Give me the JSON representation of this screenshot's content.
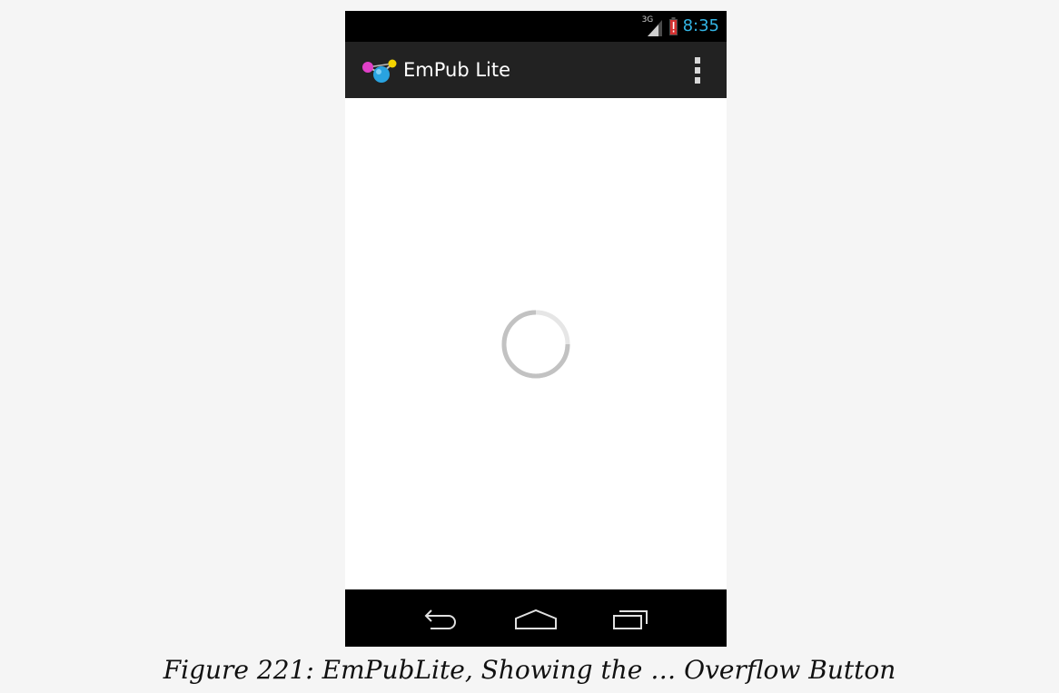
{
  "status_bar": {
    "network_type": "3G",
    "time": "8:35",
    "icons": [
      "signal-icon",
      "battery-low-icon"
    ]
  },
  "action_bar": {
    "app_icon": "empub-logo-icon",
    "title": "EmPub Lite",
    "overflow_icon": "overflow-menu-icon"
  },
  "content": {
    "loading_icon": "progress-spinner-icon"
  },
  "nav_bar": {
    "icons": [
      "back-icon",
      "home-icon",
      "recent-apps-icon"
    ]
  },
  "caption": "Figure 221: EmPubLite, Showing the … Overflow Button",
  "colors": {
    "status_bar_bg": "#000000",
    "action_bar_bg": "#222222",
    "clock_color": "#33b5e5",
    "battery_warning": "#d32f2f",
    "nav_bar_bg": "#000000",
    "page_bg": "#f5f5f5"
  }
}
